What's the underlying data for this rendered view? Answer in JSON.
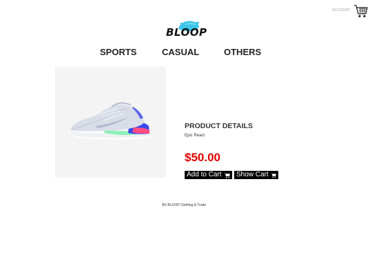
{
  "header": {
    "account_label": "ACCOUNT",
    "logo_text": "BLOOP"
  },
  "nav": {
    "items": [
      {
        "label": "SPORTS"
      },
      {
        "label": "CASUAL"
      },
      {
        "label": "OTHERS"
      }
    ]
  },
  "product": {
    "details_title": "PRODUCT DETAILS",
    "name": "Epic React",
    "price": "$50.00",
    "image_icon": "sneaker-image"
  },
  "actions": {
    "add_to_cart_label": "Add to Cart",
    "show_cart_label": "Show Cart"
  },
  "footer": {
    "text": "Â© BLOOP Clothing & Trade"
  },
  "colors": {
    "price": "#e00000",
    "button_bg": "#000000",
    "image_bg": "#f4f4f4"
  }
}
